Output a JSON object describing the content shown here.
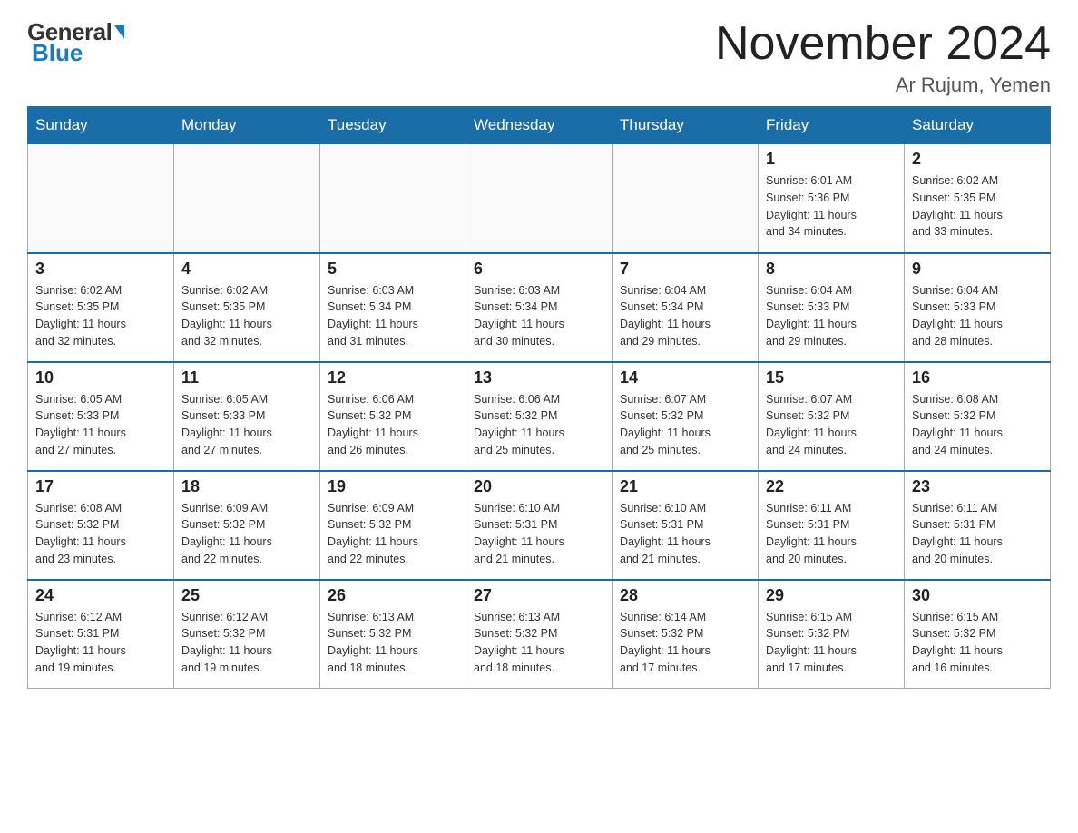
{
  "header": {
    "logo_general": "General",
    "logo_blue": "Blue",
    "month_title": "November 2024",
    "location": "Ar Rujum, Yemen"
  },
  "days_of_week": [
    "Sunday",
    "Monday",
    "Tuesday",
    "Wednesday",
    "Thursday",
    "Friday",
    "Saturday"
  ],
  "weeks": [
    [
      {
        "day": "",
        "info": ""
      },
      {
        "day": "",
        "info": ""
      },
      {
        "day": "",
        "info": ""
      },
      {
        "day": "",
        "info": ""
      },
      {
        "day": "",
        "info": ""
      },
      {
        "day": "1",
        "info": "Sunrise: 6:01 AM\nSunset: 5:36 PM\nDaylight: 11 hours\nand 34 minutes."
      },
      {
        "day": "2",
        "info": "Sunrise: 6:02 AM\nSunset: 5:35 PM\nDaylight: 11 hours\nand 33 minutes."
      }
    ],
    [
      {
        "day": "3",
        "info": "Sunrise: 6:02 AM\nSunset: 5:35 PM\nDaylight: 11 hours\nand 32 minutes."
      },
      {
        "day": "4",
        "info": "Sunrise: 6:02 AM\nSunset: 5:35 PM\nDaylight: 11 hours\nand 32 minutes."
      },
      {
        "day": "5",
        "info": "Sunrise: 6:03 AM\nSunset: 5:34 PM\nDaylight: 11 hours\nand 31 minutes."
      },
      {
        "day": "6",
        "info": "Sunrise: 6:03 AM\nSunset: 5:34 PM\nDaylight: 11 hours\nand 30 minutes."
      },
      {
        "day": "7",
        "info": "Sunrise: 6:04 AM\nSunset: 5:34 PM\nDaylight: 11 hours\nand 29 minutes."
      },
      {
        "day": "8",
        "info": "Sunrise: 6:04 AM\nSunset: 5:33 PM\nDaylight: 11 hours\nand 29 minutes."
      },
      {
        "day": "9",
        "info": "Sunrise: 6:04 AM\nSunset: 5:33 PM\nDaylight: 11 hours\nand 28 minutes."
      }
    ],
    [
      {
        "day": "10",
        "info": "Sunrise: 6:05 AM\nSunset: 5:33 PM\nDaylight: 11 hours\nand 27 minutes."
      },
      {
        "day": "11",
        "info": "Sunrise: 6:05 AM\nSunset: 5:33 PM\nDaylight: 11 hours\nand 27 minutes."
      },
      {
        "day": "12",
        "info": "Sunrise: 6:06 AM\nSunset: 5:32 PM\nDaylight: 11 hours\nand 26 minutes."
      },
      {
        "day": "13",
        "info": "Sunrise: 6:06 AM\nSunset: 5:32 PM\nDaylight: 11 hours\nand 25 minutes."
      },
      {
        "day": "14",
        "info": "Sunrise: 6:07 AM\nSunset: 5:32 PM\nDaylight: 11 hours\nand 25 minutes."
      },
      {
        "day": "15",
        "info": "Sunrise: 6:07 AM\nSunset: 5:32 PM\nDaylight: 11 hours\nand 24 minutes."
      },
      {
        "day": "16",
        "info": "Sunrise: 6:08 AM\nSunset: 5:32 PM\nDaylight: 11 hours\nand 24 minutes."
      }
    ],
    [
      {
        "day": "17",
        "info": "Sunrise: 6:08 AM\nSunset: 5:32 PM\nDaylight: 11 hours\nand 23 minutes."
      },
      {
        "day": "18",
        "info": "Sunrise: 6:09 AM\nSunset: 5:32 PM\nDaylight: 11 hours\nand 22 minutes."
      },
      {
        "day": "19",
        "info": "Sunrise: 6:09 AM\nSunset: 5:32 PM\nDaylight: 11 hours\nand 22 minutes."
      },
      {
        "day": "20",
        "info": "Sunrise: 6:10 AM\nSunset: 5:31 PM\nDaylight: 11 hours\nand 21 minutes."
      },
      {
        "day": "21",
        "info": "Sunrise: 6:10 AM\nSunset: 5:31 PM\nDaylight: 11 hours\nand 21 minutes."
      },
      {
        "day": "22",
        "info": "Sunrise: 6:11 AM\nSunset: 5:31 PM\nDaylight: 11 hours\nand 20 minutes."
      },
      {
        "day": "23",
        "info": "Sunrise: 6:11 AM\nSunset: 5:31 PM\nDaylight: 11 hours\nand 20 minutes."
      }
    ],
    [
      {
        "day": "24",
        "info": "Sunrise: 6:12 AM\nSunset: 5:31 PM\nDaylight: 11 hours\nand 19 minutes."
      },
      {
        "day": "25",
        "info": "Sunrise: 6:12 AM\nSunset: 5:32 PM\nDaylight: 11 hours\nand 19 minutes."
      },
      {
        "day": "26",
        "info": "Sunrise: 6:13 AM\nSunset: 5:32 PM\nDaylight: 11 hours\nand 18 minutes."
      },
      {
        "day": "27",
        "info": "Sunrise: 6:13 AM\nSunset: 5:32 PM\nDaylight: 11 hours\nand 18 minutes."
      },
      {
        "day": "28",
        "info": "Sunrise: 6:14 AM\nSunset: 5:32 PM\nDaylight: 11 hours\nand 17 minutes."
      },
      {
        "day": "29",
        "info": "Sunrise: 6:15 AM\nSunset: 5:32 PM\nDaylight: 11 hours\nand 17 minutes."
      },
      {
        "day": "30",
        "info": "Sunrise: 6:15 AM\nSunset: 5:32 PM\nDaylight: 11 hours\nand 16 minutes."
      }
    ]
  ]
}
